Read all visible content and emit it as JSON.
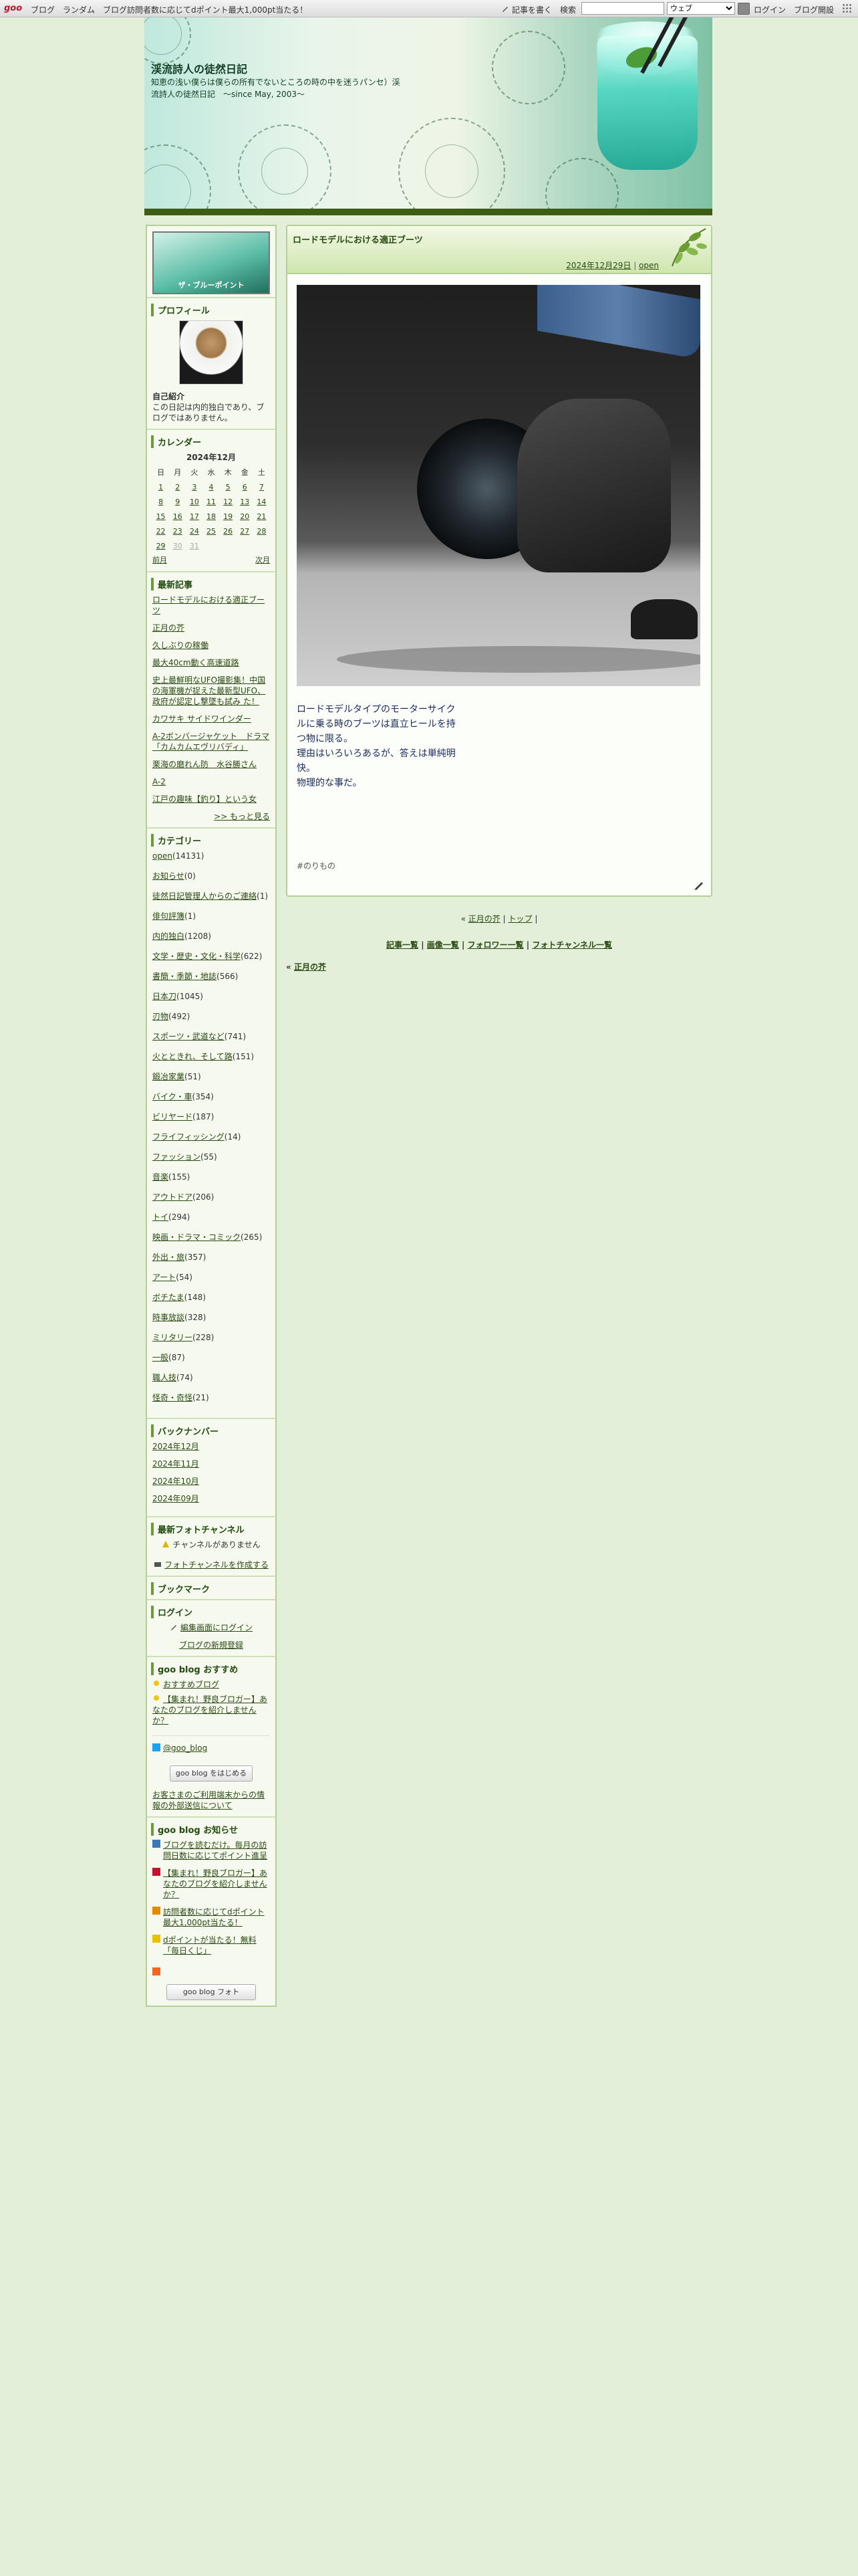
{
  "topbar": {
    "logo": "goo",
    "links": [
      "ブログ",
      "ランダム",
      "ブログ訪問者数に応じてdポイント最大1,000pt当たる！"
    ],
    "write": "記事を書く",
    "search_label": "検索",
    "search_scope": "ウェブ",
    "login": "ログイン",
    "signup": "ブログ開設"
  },
  "header": {
    "title": "渓流詩人の徒然日記",
    "description": "知恵の浅い僕らは僕らの所有でないところの時の中を迷うパンセ）渓流詩人の徒然日記　～since May, 2003～"
  },
  "sidebar": {
    "banner_text": "ザ・ブルーポイント",
    "profile": {
      "heading": "プロフィール",
      "intro_label": "自己紹介",
      "intro_text": "この日記は内的独白であり、ブログではありません。"
    },
    "calendar": {
      "heading": "カレンダー",
      "month": "2024年12月",
      "weekdays": [
        "日",
        "月",
        "火",
        "水",
        "木",
        "金",
        "土"
      ],
      "weeks": [
        [
          "1",
          "2",
          "3",
          "4",
          "5",
          "6",
          "7"
        ],
        [
          "8",
          "9",
          "10",
          "11",
          "12",
          "13",
          "14"
        ],
        [
          "15",
          "16",
          "17",
          "18",
          "19",
          "20",
          "21"
        ],
        [
          "22",
          "23",
          "24",
          "25",
          "26",
          "27",
          "28"
        ],
        [
          "29",
          "30",
          "31",
          "",
          "",
          "",
          ""
        ]
      ],
      "prev": "前月",
      "next": "次月"
    },
    "recent": {
      "heading": "最新記事",
      "items": [
        "ロードモデルにおける適正ブーツ",
        "正月の芥",
        "久しぶりの稼働",
        "最大40cm動く高速道路",
        "史上最鮮明なUFO撮影集！中国の海軍機が捉えた最新型UFO、政府が認定し撃墜も試み た！",
        "カワサキ サイドワインダー",
        "A-2ボンバージャケット　ドラマ「カムカムエヴリバディ」",
        "栗海の磨れん防　水谷勝さん",
        "A-2",
        "江戸の趣味【釣り】という女"
      ],
      "more": ">> もっと見る"
    },
    "categories": {
      "heading": "カテゴリー",
      "items": [
        "open(14131)",
        "お知らせ(0)",
        "徒然日記管理人からのご連絡(1)",
        "俳句評簿(1)",
        "内的独白(1208)",
        "文学・歴史・文化・科学(622)",
        "書簡・季節・地誌(566)",
        "日本刀(1045)",
        "刃物(492)",
        "スポーツ・武道など(741)",
        "火とときれ、そして路(151)",
        "鍛冶家業(51)",
        "バイク・車(354)",
        "ビリヤード(187)",
        "フライフィッシング(14)",
        "ファッション(55)",
        "音楽(155)",
        "アウトドア(206)",
        "トイ(294)",
        "映画・ドラマ・コミック(265)",
        "外出・旅(357)",
        "アート(54)",
        "ボチたま(148)",
        "時事放談(328)",
        "ミリタリー(228)",
        "一般(87)",
        "職人技(74)",
        "怪奇・奇怪(21)"
      ]
    },
    "backnumber": {
      "heading": "バックナンバー",
      "items": [
        "2024年12月",
        "2024年11月",
        "2024年10月",
        "2024年09月"
      ]
    },
    "photochannel": {
      "heading": "最新フォトチャンネル",
      "empty": "チャンネルがありません",
      "create": "フォトチャンネルを作成する"
    },
    "bookmark": {
      "heading": "ブックマーク"
    },
    "login": {
      "heading": "ログイン",
      "edit": "編集画面にログイン",
      "register": "ブログの新規登録"
    },
    "recommend": {
      "heading": "goo blog おすすめ",
      "items": [
        "おすすめブログ",
        "【集まれ！野良ブロガー】あなたのブログを紹介しませんか？"
      ],
      "twitter": "@goo_blog",
      "badge": "goo blog をはじめる",
      "notice": "お客さまのご利用端末からの情報の外部送信について"
    },
    "news": {
      "heading": "goo blog お知らせ",
      "items": [
        "ブログを読むだけ。毎月の訪問日数に応じてポイント進呈",
        "【集まれ！野良ブロガー】あなたのブログを紹介しませんか？",
        "訪問者数に応じてdポイント最大1,000pt当たる！",
        "dポイントが当たる！無料「毎日くじ」"
      ]
    },
    "rss": "RSS",
    "photo_badge": "goo blog フォト"
  },
  "entry": {
    "title": "ロードモデルにおける適正ブーツ",
    "date": "2024年12月29日",
    "category": "open",
    "body": "ロードモデルタイプのモーターサイクルに乗る時のブーツは直立ヒールを持つ物に限る。\n理由はいろいろあるが、答えは単純明快。\n物理的な事だ。",
    "tag": "#のりもの"
  },
  "footer": {
    "page_prev": "正月の芥",
    "page_top": "トップ",
    "links": [
      "記事一覧",
      "画像一覧",
      "フォロワー一覧",
      "フォトチャンネル一覧"
    ],
    "prev_entry": "正月の芥",
    "prev_arrow": "«"
  },
  "colors": {
    "background": "#e4efd9",
    "accent_dark": "#3d5c14",
    "sidebar_border": "#b5cf98",
    "text_blue": "#1c2a5e"
  }
}
